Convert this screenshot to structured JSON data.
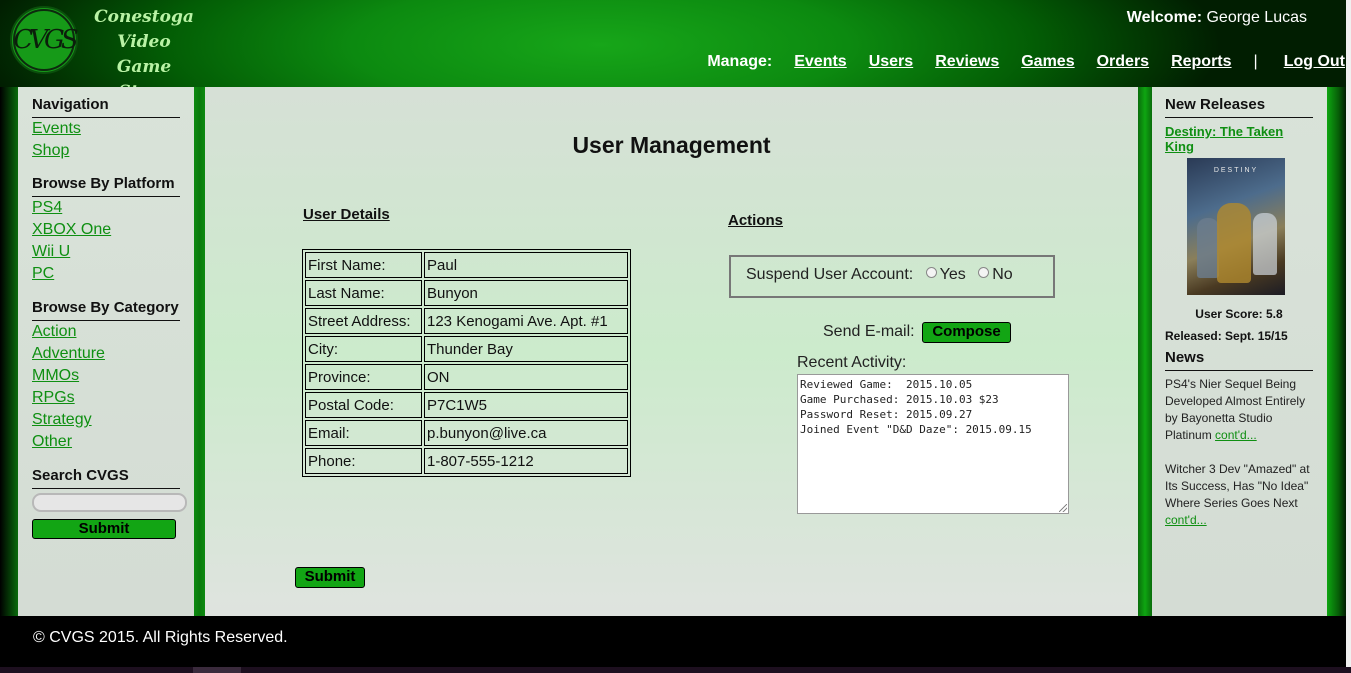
{
  "header": {
    "logo_initials": "CVGS",
    "logo_lines": [
      "Conestoga",
      "Video Game",
      "Store"
    ],
    "welcome_label": "Welcome:",
    "welcome_user": "George Lucas",
    "manage_label": "Manage:",
    "nav": [
      "Events",
      "Users",
      "Reviews",
      "Games",
      "Orders",
      "Reports"
    ],
    "separator": "|",
    "logout": "Log Out"
  },
  "sidebar": {
    "nav_heading": "Navigation",
    "nav_links": [
      "Events",
      "Shop"
    ],
    "platform_heading": "Browse By Platform",
    "platforms": [
      "PS4",
      "XBOX One",
      "Wii U",
      "PC"
    ],
    "category_heading": "Browse By Category",
    "categories": [
      "Action",
      "Adventure",
      "MMOs",
      "RPGs",
      "Strategy",
      "Other"
    ],
    "search_heading": "Search CVGS",
    "search_value": "",
    "submit_label": "Submit"
  },
  "main": {
    "title": "User Management",
    "details_heading": "User Details",
    "details": [
      {
        "label": "First Name:",
        "value": "Paul"
      },
      {
        "label": "Last Name:",
        "value": "Bunyon"
      },
      {
        "label": "Street Address:",
        "value": "123 Kenogami Ave. Apt. #1"
      },
      {
        "label": "City:",
        "value": "Thunder Bay"
      },
      {
        "label": "Province:",
        "value": "ON"
      },
      {
        "label": "Postal Code:",
        "value": "P7C1W5"
      },
      {
        "label": "Email:",
        "value": "p.bunyon@live.ca"
      },
      {
        "label": "Phone:",
        "value": "1-807-555-1212"
      }
    ],
    "actions_heading": "Actions",
    "suspend_label": "Suspend User Account:",
    "suspend_yes": "Yes",
    "suspend_no": "No",
    "send_email_label": "Send E-mail:",
    "compose_label": "Compose",
    "recent_label": "Recent Activity:",
    "recent_activity": "Reviewed Game:  2015.10.05\nGame Purchased: 2015.10.03 $23\nPassword Reset: 2015.09.27\nJoined Event \"D&D Daze\": 2015.09.15",
    "submit_label": "Submit"
  },
  "right": {
    "releases_heading": "New Releases",
    "release_title": "Destiny: The Taken King",
    "cover_logo": "DESTINY",
    "user_score": "User Score: 5.8",
    "released": "Released: Sept. 15/15",
    "news_heading": "News",
    "news": [
      {
        "text": "PS4's Nier Sequel Being Developed Almost Entirely by Bayonetta Studio Platinum ",
        "link": "cont'd..."
      },
      {
        "text": "Witcher 3 Dev \"Amazed\" at Its Success, Has \"No Idea\" Where Series Goes Next ",
        "link": "cont'd..."
      }
    ]
  },
  "footer": {
    "text": "© CVGS 2015. All Rights Reserved."
  },
  "colors": {
    "accent_green": "#12a514",
    "link_green": "#0f8f12",
    "header_green": "#17a619"
  }
}
